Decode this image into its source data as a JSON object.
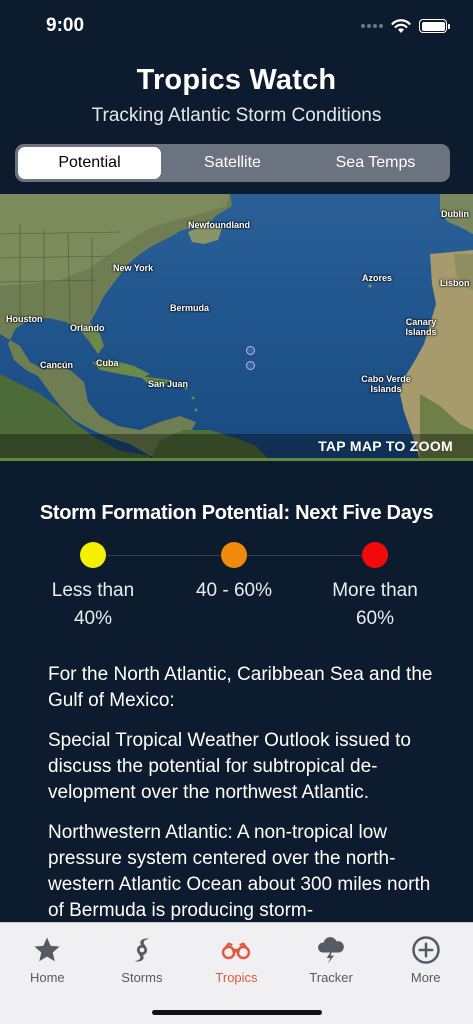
{
  "status": {
    "time": "9:00"
  },
  "header": {
    "title": "Tropics Watch",
    "subtitle": "Tracking Atlantic Storm Conditions"
  },
  "segments": [
    {
      "label": "Potential",
      "active": true
    },
    {
      "label": "Satellite",
      "active": false
    },
    {
      "label": "Sea Temps",
      "active": false
    }
  ],
  "map": {
    "labels": {
      "newfoundland": "Newfoundland",
      "dublin": "Dublin",
      "new_york": "New York",
      "azores": "Azores",
      "lisbon": "Lisbon",
      "bermuda": "Bermuda",
      "houston": "Houston",
      "orlando": "Orlando",
      "canary_islands": "Canary Islands",
      "cancun": "Cancún",
      "cuba": "Cuba",
      "san_juan": "San Juan",
      "cabo_verde": "Cabo Verde Islands"
    },
    "zoom_hint": "TAP MAP TO ZOOM"
  },
  "legend": {
    "title": "Storm Formation Potential: Next Five Days",
    "items": [
      {
        "line1": "Less than",
        "line2": "40%",
        "color": "#f5ef00"
      },
      {
        "line1": "40 - 60%",
        "line2": "",
        "color": "#f08a0c"
      },
      {
        "line1": "More than",
        "line2": "60%",
        "color": "#f20a0a"
      }
    ]
  },
  "outlook": {
    "p1": "For the North Atlantic, Caribbean Sea and the Gulf of Mexico:",
    "p2": "Special Tropical Weather Outlook issued to discuss the potential for subtropical de-velopment over the northwest Atlantic.",
    "p3": "Northwestern Atlantic: A non-tropical low pressure system centered over the north-western Atlantic Ocean about 300 miles north of Bermuda is producing storm-"
  },
  "tabs": [
    {
      "label": "Home",
      "icon": "star-icon",
      "active": false
    },
    {
      "label": "Storms",
      "icon": "hurricane-icon",
      "active": false
    },
    {
      "label": "Tropics",
      "icon": "binoculars-icon",
      "active": true
    },
    {
      "label": "Tracker",
      "icon": "storm-cloud-icon",
      "active": false
    },
    {
      "label": "More",
      "icon": "plus-circle-icon",
      "active": false
    }
  ],
  "colors": {
    "background": "#0d1b2e",
    "accent": "#e0593d",
    "segment_track": "#6c7380"
  }
}
